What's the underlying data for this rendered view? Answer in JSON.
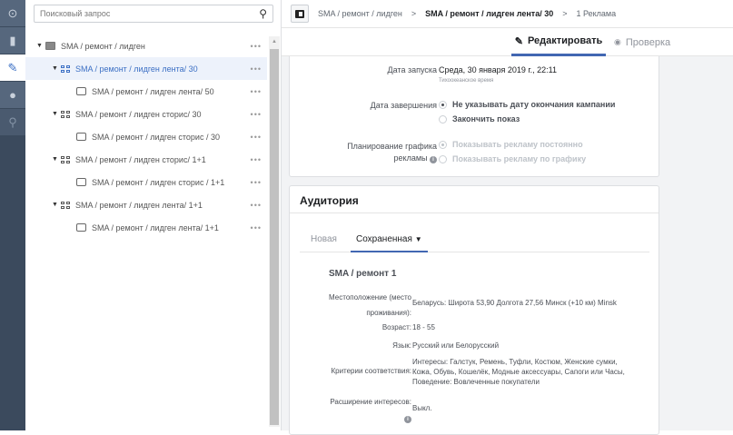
{
  "rail": [
    {
      "icon": "expand-icon"
    },
    {
      "icon": "chart-icon"
    },
    {
      "icon": "pencil-icon"
    },
    {
      "icon": "clock-icon"
    },
    {
      "icon": "search-chart-icon"
    }
  ],
  "search": {
    "placeholder": "Поисковый запрос"
  },
  "tree": [
    {
      "label": "SMA / ремонт / лидген",
      "type": "campaign",
      "level": 0,
      "selected": false
    },
    {
      "label": "SMA / ремонт / лидген лента/ 30",
      "type": "adset",
      "level": 1,
      "selected": true
    },
    {
      "label": "SMA / ремонт / лидген лента/ 50",
      "type": "ad",
      "level": 2,
      "selected": false
    },
    {
      "label": "SMA / ремонт / лидген сторис/ 30",
      "type": "adset",
      "level": 1,
      "selected": false
    },
    {
      "label": "SMA / ремонт / лидген сторис / 30",
      "type": "ad",
      "level": 2,
      "selected": false
    },
    {
      "label": "SMA / ремонт / лидген сторис/ 1+1",
      "type": "adset",
      "level": 1,
      "selected": false
    },
    {
      "label": "SMA / ремонт / лидген сторис / 1+1",
      "type": "ad",
      "level": 2,
      "selected": false
    },
    {
      "label": "SMA / ремонт / лидген лента/ 1+1",
      "type": "adset",
      "level": 1,
      "selected": false
    },
    {
      "label": "SMA / ремонт / лидген лента/ 1+1",
      "type": "ad",
      "level": 2,
      "selected": false
    }
  ],
  "more": "•••",
  "breadcrumb": {
    "items": [
      "SMA / ремонт / лидген",
      "SMA / ремонт / лидген лента/ 30",
      "1 Реклама"
    ],
    "sep": ">"
  },
  "tabs": {
    "edit": "Редактировать",
    "review": "Проверка"
  },
  "schedule": {
    "start_label": "Дата запуска",
    "start_value": "Среда, 30 января 2019 г., 22:11",
    "timezone": "Тихоокеанское время",
    "end_label": "Дата завершения",
    "end_opt1": "Не указывать дату окончания кампании",
    "end_opt2": "Закончить показ",
    "plan_label1": "Планирование графика",
    "plan_label2": "рекламы",
    "plan_opt1": "Показывать рекламу постоянно",
    "plan_opt2": "Показывать рекламу по графику"
  },
  "audience": {
    "title": "Аудитория",
    "tab_new": "Новая",
    "tab_saved": "Сохраненная",
    "name": "SMA / ремонт 1",
    "loc_label1": "Местоположение (место",
    "loc_label2": "проживания):",
    "loc_value": "Беларусь: Широта 53,90 Долгота 27,56 Минск (+10 км) Minsk",
    "age_label": "Возраст:",
    "age_value": "18 - 55",
    "lang_label": "Язык:",
    "lang_value": "Русский или Белорусский",
    "crit_label": "Критерии соответствия:",
    "crit_line1": "Интересы: Галстук, Ремень, Туфли, Костюм, Женские сумки,",
    "crit_line2": "Кожа, Обувь, Кошелёк, Модные аксессуары, Сапоги или Часы,",
    "crit_line3": "Поведение: Вовлеченные покупатели",
    "exp_label": "Расширение интересов:",
    "exp_value": "Выкл."
  }
}
